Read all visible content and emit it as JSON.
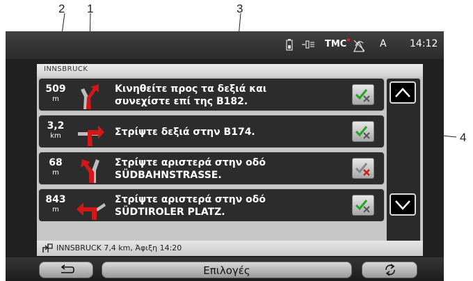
{
  "callouts": [
    "2",
    "1",
    "3",
    "4"
  ],
  "status": {
    "tmc": "TMC",
    "mode": "A",
    "time": "14:12"
  },
  "route": {
    "header": "INNSBRUCK"
  },
  "maneuvers": [
    {
      "distance": "509",
      "unit": "m",
      "line1": "Κινηθείτε προς τα δεξιά και",
      "line2": "συνεχίστε επί της B182.",
      "check": "green"
    },
    {
      "distance": "3,2",
      "unit": "km",
      "line1": "Στρίψτε δεξιά στην B174.",
      "line2": "",
      "check": "green"
    },
    {
      "distance": "68",
      "unit": "m",
      "line1": "Στρίψτε αριστερά στην οδό",
      "line2": "SÜDBAHNSTRASSE.",
      "check": "red"
    },
    {
      "distance": "843",
      "unit": "m",
      "line1": "Στρίψτε αριστερά στην οδό",
      "line2": "SÜDTIROLER PLATZ.",
      "check": "green"
    }
  ],
  "footer": {
    "text": "INNSBRUCK 7,4 km, Άφιξη 14:20"
  },
  "buttons": {
    "options": "Επιλογές"
  },
  "colors": {
    "accent_red": "#d01818",
    "check_green": "#22a522",
    "check_red": "#cc1a1a",
    "panel_bg": "#2c2c2c"
  },
  "icons": [
    "battery-icon",
    "signal-icon",
    "gps-icon",
    "back-icon",
    "refresh-icon",
    "scroll-up-icon",
    "scroll-down-icon",
    "destination-flag-icon"
  ]
}
